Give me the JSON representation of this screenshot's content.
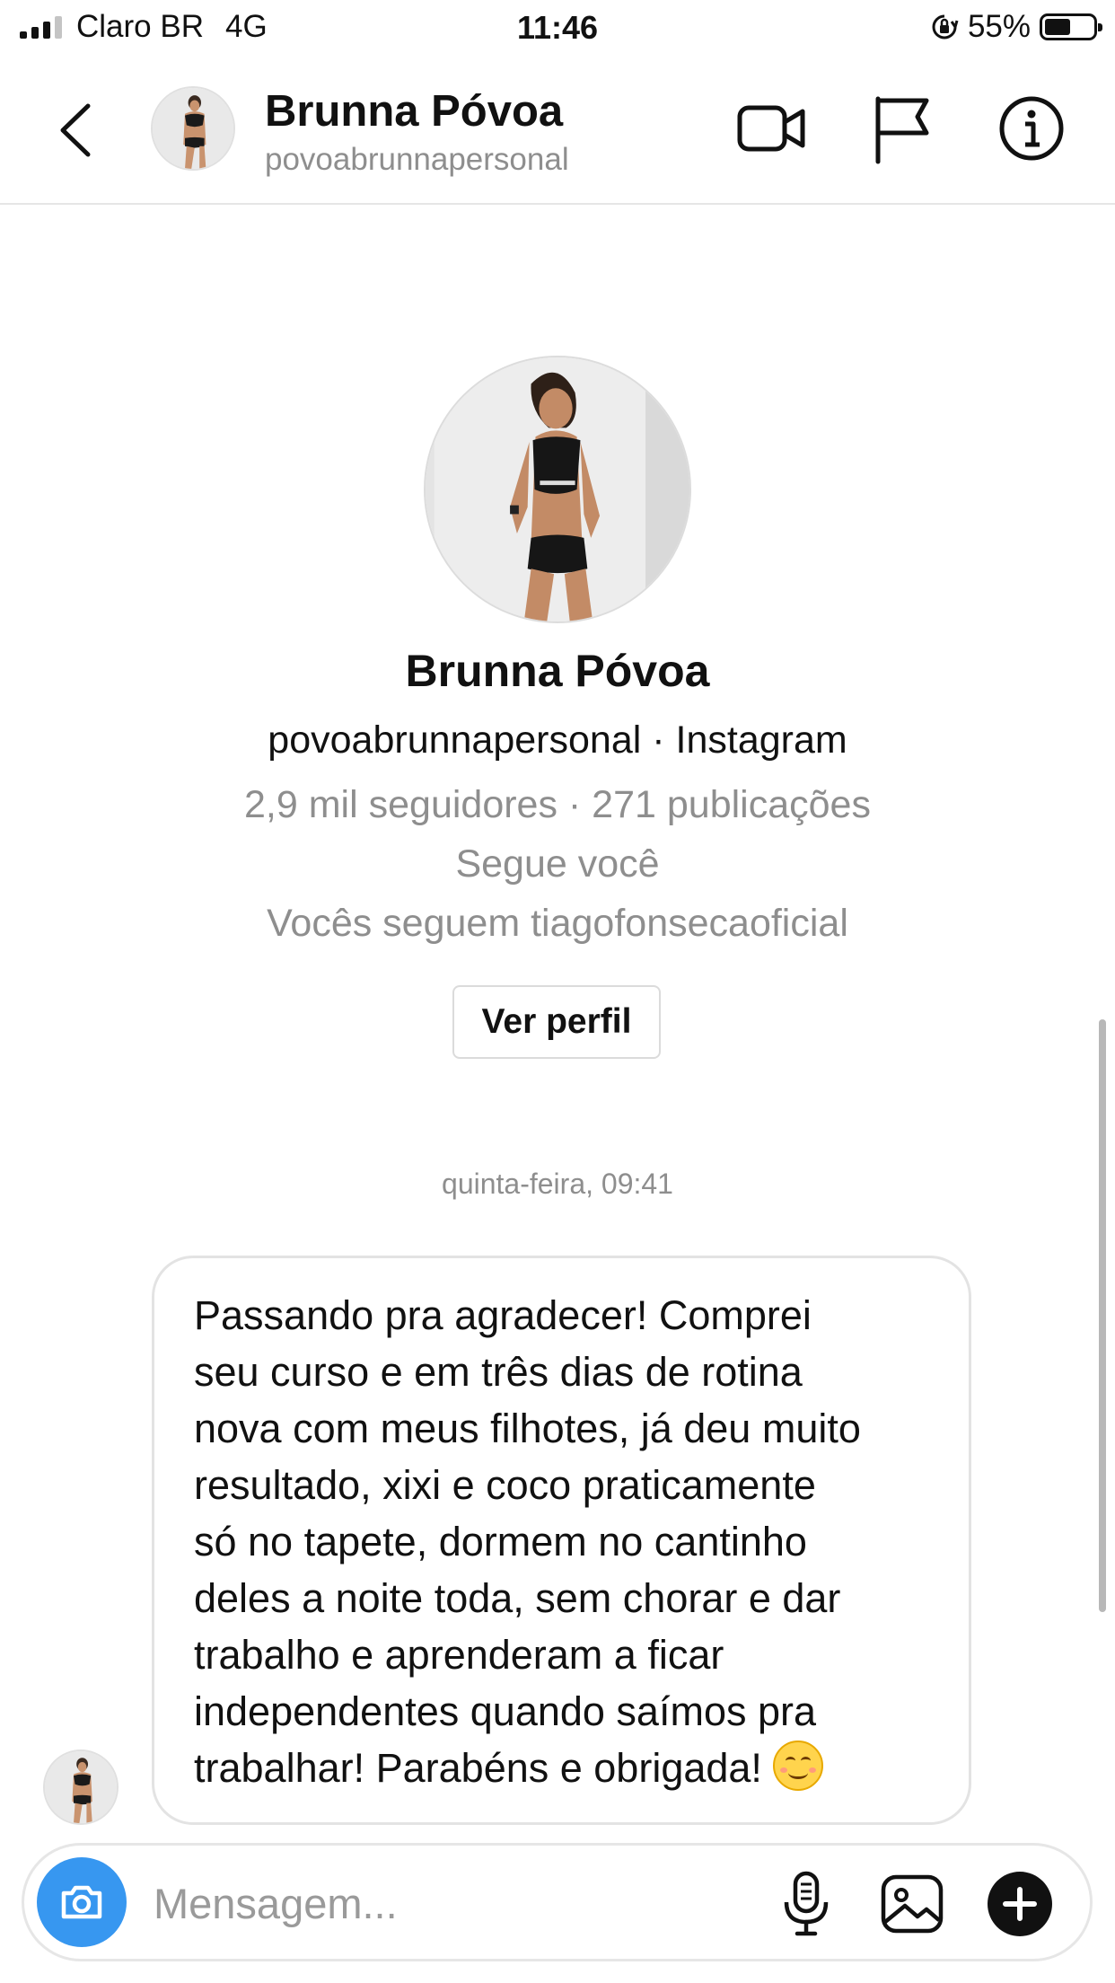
{
  "status_bar": {
    "carrier": "Claro BR",
    "network": "4G",
    "time": "11:46",
    "battery": "55%",
    "battery_level": 0.55
  },
  "header": {
    "name": "Brunna Póvoa",
    "username": "povoabrunnapersonal",
    "icons": [
      "back-arrow-icon",
      "video-camera-icon",
      "flag-icon",
      "info-icon"
    ]
  },
  "profile": {
    "name": "Brunna Póvoa",
    "subtitle": "povoabrunnapersonal · Instagram",
    "stats": "2,9 mil seguidores · 271 publicações",
    "follows_you": "Segue você",
    "mutual": "Vocês seguem tiagofonsecaoficial",
    "view_profile_label": "Ver perfil"
  },
  "thread": {
    "timestamp": "quinta-feira, 09:41",
    "messages": [
      {
        "lines": [
          "Passando pra agradecer! Comprei",
          "seu curso e em três dias de rotina",
          "nova com meus filhotes, já deu muito",
          "resultado, xixi e coco praticamente",
          "só no tapete, dormem no cantinho",
          "deles a noite toda, sem chorar e dar",
          "trabalho e aprenderam a ficar",
          "independentes quando saímos pra",
          "trabalhar! Parabéns e obrigada!"
        ],
        "emoji": "smiling-face-emoji"
      }
    ]
  },
  "composer": {
    "placeholder": "Mensagem...",
    "icons": [
      "camera-icon",
      "microphone-icon",
      "gallery-icon",
      "plus-icon"
    ]
  },
  "colors": {
    "accent_blue": "#3797f0",
    "secondary_text": "#8e8e8e",
    "border": "#e6e6e6"
  }
}
